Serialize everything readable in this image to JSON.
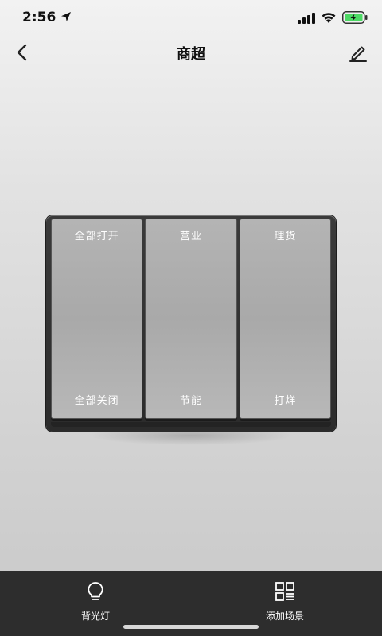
{
  "status_bar": {
    "time": "2:56",
    "icons": [
      "location-arrow-icon",
      "signal-icon",
      "wifi-icon",
      "battery-charging-icon"
    ],
    "battery_color": "#4cd964"
  },
  "header": {
    "title": "商超",
    "back_icon": "chevron-left-icon",
    "edit_icon": "pencil-icon"
  },
  "switch_panel": {
    "keys": [
      {
        "top_label": "全部打开",
        "bottom_label": "全部关闭"
      },
      {
        "top_label": "营业",
        "bottom_label": "节能"
      },
      {
        "top_label": "理货",
        "bottom_label": "打烊"
      }
    ]
  },
  "bottom_bar": {
    "background": "#2d2d2d",
    "actions": [
      {
        "label": "背光灯",
        "icon": "bulb-icon"
      },
      {
        "label": "添加场景",
        "icon": "grid-list-icon"
      }
    ]
  }
}
